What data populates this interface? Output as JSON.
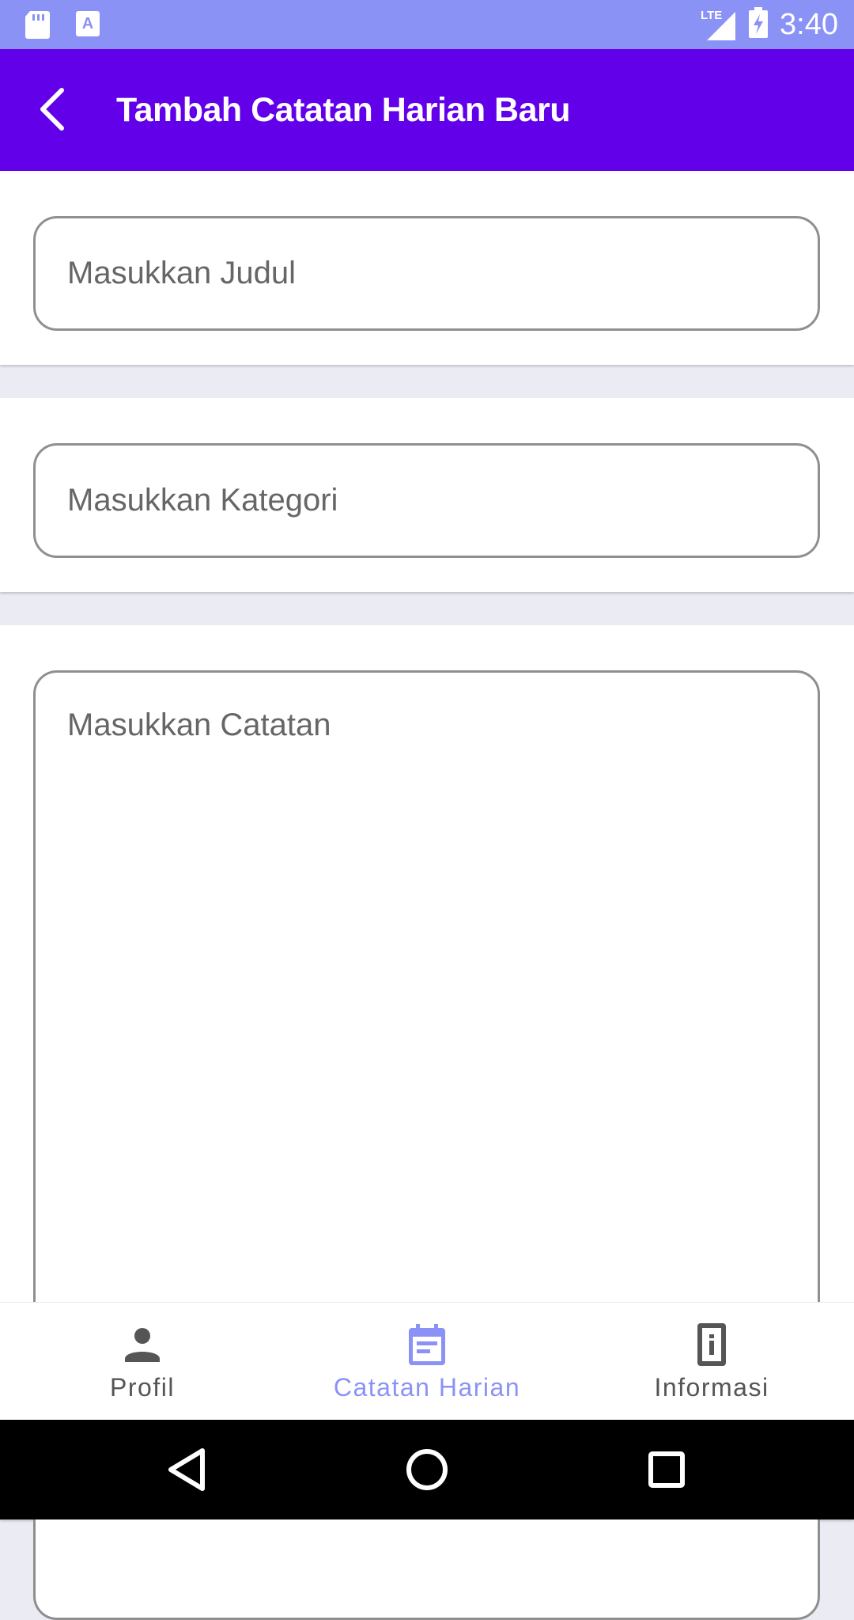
{
  "status_bar": {
    "time": "3:40",
    "network": "LTE",
    "icons": [
      "sd-card-icon",
      "a-notification-icon",
      "lte-signal-icon",
      "battery-charging-icon"
    ]
  },
  "app_bar": {
    "title": "Tambah Catatan Harian Baru",
    "back_icon": "back-arrow-icon",
    "color": "#6200ea"
  },
  "form": {
    "title_placeholder": "Masukkan Judul",
    "category_placeholder": "Masukkan Kategori",
    "note_placeholder": "Masukkan Catatan"
  },
  "bottom_nav": {
    "items": [
      {
        "label": "Profil",
        "icon": "person-icon",
        "active": false
      },
      {
        "label": "Catatan Harian",
        "icon": "calendar-note-icon",
        "active": true
      },
      {
        "label": "Informasi",
        "icon": "info-device-icon",
        "active": false
      }
    ],
    "active_color": "#8a92f5",
    "inactive_color": "#555555"
  },
  "system_nav": {
    "buttons": [
      "back-triangle-icon",
      "home-circle-icon",
      "recents-square-icon"
    ]
  }
}
